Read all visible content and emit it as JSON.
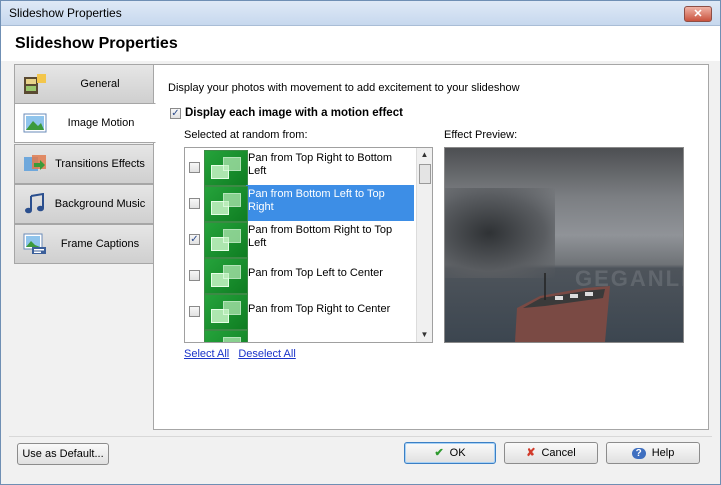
{
  "window": {
    "title": "Slideshow Properties",
    "close_label": "✕"
  },
  "header": {
    "title": "Slideshow Properties"
  },
  "tabs": [
    {
      "label": "General",
      "icon": "film-icon",
      "active": false
    },
    {
      "label": "Image Motion",
      "icon": "landscape-icon",
      "active": true
    },
    {
      "label": "Transitions Effects",
      "icon": "transition-icon",
      "active": false
    },
    {
      "label": "Background Music",
      "icon": "music-note-icon",
      "active": false
    },
    {
      "label": "Frame Captions",
      "icon": "caption-file-icon",
      "active": false
    }
  ],
  "motion": {
    "description": "Display your photos with movement to add excitement to your slideshow",
    "enable_label": "Display each image with a motion effect",
    "enable_checked": true,
    "random_label": "Selected at random from:",
    "preview_label": "Effect Preview:",
    "items": [
      {
        "text": "Pan from Top Right to Bottom Left",
        "checked": false,
        "selected": false
      },
      {
        "text": "Pan from Bottom Left to Top Right",
        "checked": false,
        "selected": true
      },
      {
        "text": "Pan from Bottom Right to Top Left",
        "checked": true,
        "selected": false
      },
      {
        "text": "Pan from Top Left to Center",
        "checked": false,
        "selected": false
      },
      {
        "text": "Pan from Top Right to Center",
        "checked": false,
        "selected": false
      }
    ],
    "select_all": "Select All",
    "deselect_all": "Deselect All",
    "watermark": "GEGANLES"
  },
  "footer": {
    "default_label": "Use as Default...",
    "ok_label": "OK",
    "cancel_label": "Cancel",
    "help_label": "Help"
  }
}
